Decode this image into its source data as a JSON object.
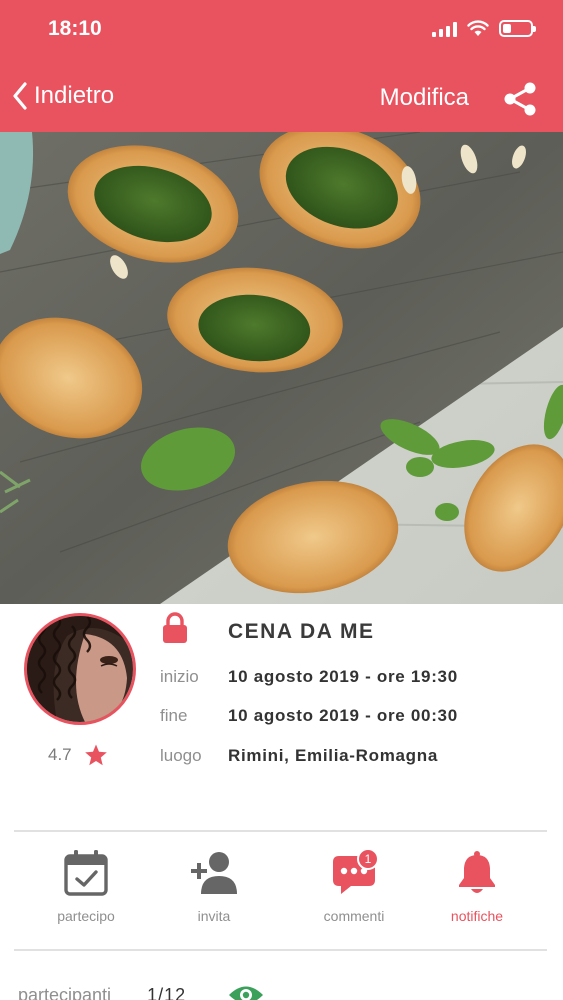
{
  "status_bar": {
    "time": "18:10"
  },
  "nav": {
    "back_label": "Indietro",
    "edit_label": "Modifica",
    "share_icon": "share-icon"
  },
  "host": {
    "rating": "4.7",
    "rating_icon": "star-icon"
  },
  "event": {
    "privacy_icon": "lock-icon",
    "title": "CENA DA ME",
    "start_label": "inizio",
    "start_value": "10 agosto 2019 - ore 19:30",
    "end_label": "fine",
    "end_value": "10 agosto 2019 - ore 00:30",
    "place_label": "luogo",
    "place_value": "Rimini, Emilia-Romagna"
  },
  "actions": {
    "participate_label": "partecipo",
    "invite_label": "invita",
    "comments_label": "commenti",
    "comments_badge": "1",
    "notifications_label": "notifiche"
  },
  "participants": {
    "label": "partecipanti",
    "count": "1/12"
  },
  "colors": {
    "accent": "#e8535f",
    "muted": "#8f8f8f",
    "text": "#333333"
  }
}
